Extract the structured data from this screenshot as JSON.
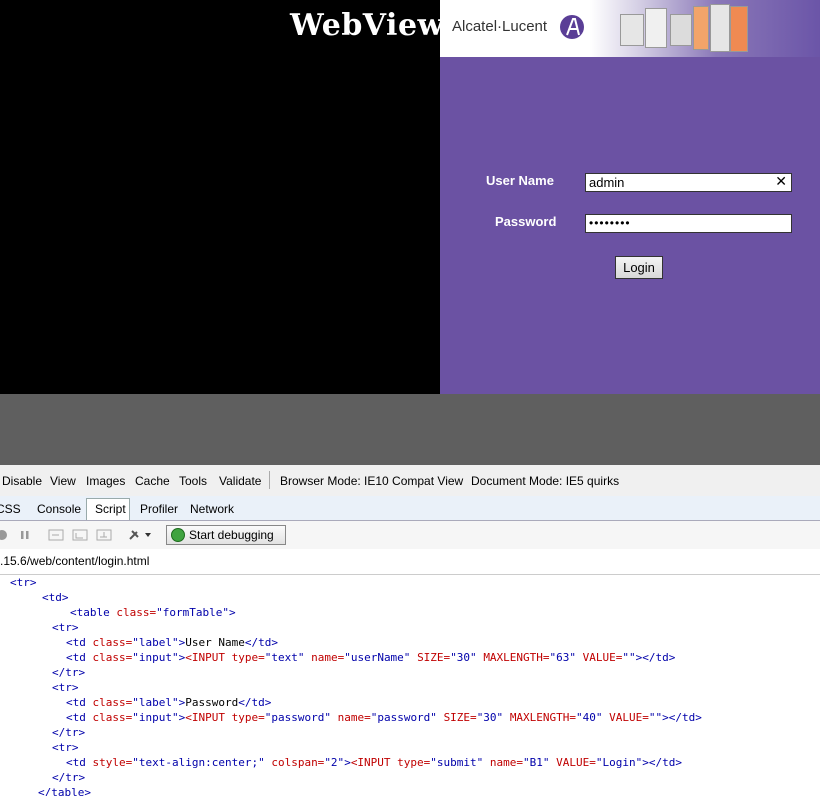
{
  "webview": {
    "title": "WebView",
    "brand": "Alcatel·Lucent",
    "form": {
      "username_label": "User Name",
      "username_value": "admin",
      "password_label": "Password",
      "password_value": "••••••••",
      "login_label": "Login",
      "clear_icon": "✕"
    },
    "colors": {
      "panel": "#6b52a3",
      "background": "#000000",
      "grey_area": "#5f5f5f"
    }
  },
  "devtools": {
    "menu": [
      "Disable",
      "View",
      "Images",
      "Cache",
      "Tools",
      "Validate"
    ],
    "browser_mode": "Browser Mode: IE10 Compat View",
    "document_mode": "Document Mode: IE5 quirks",
    "tabs": [
      "CSS",
      "Console",
      "Script",
      "Profiler",
      "Network"
    ],
    "active_tab": "Script",
    "start_debugging": "Start debugging",
    "url": ".15.6/web/content/login.html",
    "code_lines": [
      {
        "parts": [
          [
            "tg",
            "<tr>"
          ]
        ]
      },
      {
        "parts": [
          [
            "tg",
            "<td>"
          ]
        ]
      },
      {
        "parts": [
          [
            "tg",
            "<table "
          ],
          [
            "an",
            "class="
          ],
          [
            "av",
            "\"formTable\""
          ],
          [
            "tg",
            ">"
          ]
        ]
      },
      {
        "parts": [
          [
            "tg",
            "<tr>"
          ]
        ]
      },
      {
        "parts": [
          [
            "tg",
            "<td "
          ],
          [
            "an",
            "class="
          ],
          [
            "av",
            "\"label\""
          ],
          [
            "tg",
            ">"
          ],
          [
            "tx",
            "User Name"
          ],
          [
            "tg",
            "</td>"
          ]
        ]
      },
      {
        "parts": [
          [
            "tg",
            "<td "
          ],
          [
            "an",
            "class="
          ],
          [
            "av",
            "\"input\""
          ],
          [
            "tg",
            ">"
          ],
          [
            "an",
            "<INPUT "
          ],
          [
            "an",
            "type="
          ],
          [
            "av",
            "\"text\" "
          ],
          [
            "an",
            "name="
          ],
          [
            "av",
            "\"userName\" "
          ],
          [
            "an",
            "SIZE="
          ],
          [
            "av",
            "\"30\" "
          ],
          [
            "an",
            "MAXLENGTH="
          ],
          [
            "av",
            "\"63\" "
          ],
          [
            "an",
            "VALUE="
          ],
          [
            "av",
            "\"\""
          ],
          [
            "tg",
            "></td>"
          ]
        ]
      },
      {
        "parts": [
          [
            "tg",
            "</tr>"
          ]
        ]
      },
      {
        "parts": [
          [
            "tg",
            "<tr>"
          ]
        ]
      },
      {
        "parts": [
          [
            "tg",
            "<td "
          ],
          [
            "an",
            "class="
          ],
          [
            "av",
            "\"label\""
          ],
          [
            "tg",
            ">"
          ],
          [
            "tx",
            "Password"
          ],
          [
            "tg",
            "</td>"
          ]
        ]
      },
      {
        "parts": [
          [
            "tg",
            "<td "
          ],
          [
            "an",
            "class="
          ],
          [
            "av",
            "\"input\""
          ],
          [
            "tg",
            ">"
          ],
          [
            "an",
            "<INPUT "
          ],
          [
            "an",
            "type="
          ],
          [
            "av",
            "\"password\" "
          ],
          [
            "an",
            "name="
          ],
          [
            "av",
            "\"password\" "
          ],
          [
            "an",
            "SIZE="
          ],
          [
            "av",
            "\"30\" "
          ],
          [
            "an",
            "MAXLENGTH="
          ],
          [
            "av",
            "\"40\" "
          ],
          [
            "an",
            "VALUE="
          ],
          [
            "av",
            "\"\""
          ],
          [
            "tg",
            "></td>"
          ]
        ]
      },
      {
        "parts": [
          [
            "tg",
            "</tr>"
          ]
        ]
      },
      {
        "parts": [
          [
            "tg",
            "<tr>"
          ]
        ]
      },
      {
        "parts": [
          [
            "tg",
            "<td "
          ],
          [
            "an",
            "style="
          ],
          [
            "av",
            "\"text-align:center;\" "
          ],
          [
            "an",
            "colspan="
          ],
          [
            "av",
            "\"2\""
          ],
          [
            "tg",
            ">"
          ],
          [
            "an",
            "<INPUT "
          ],
          [
            "an",
            "type="
          ],
          [
            "av",
            "\"submit\" "
          ],
          [
            "an",
            "name="
          ],
          [
            "av",
            "\"B1\" "
          ],
          [
            "an",
            "VALUE="
          ],
          [
            "av",
            "\"Login\""
          ],
          [
            "tg",
            "></td>"
          ]
        ]
      },
      {
        "parts": [
          [
            "tg",
            "</tr>"
          ]
        ]
      },
      {
        "parts": [
          [
            "tg",
            "</table>"
          ]
        ]
      }
    ]
  }
}
